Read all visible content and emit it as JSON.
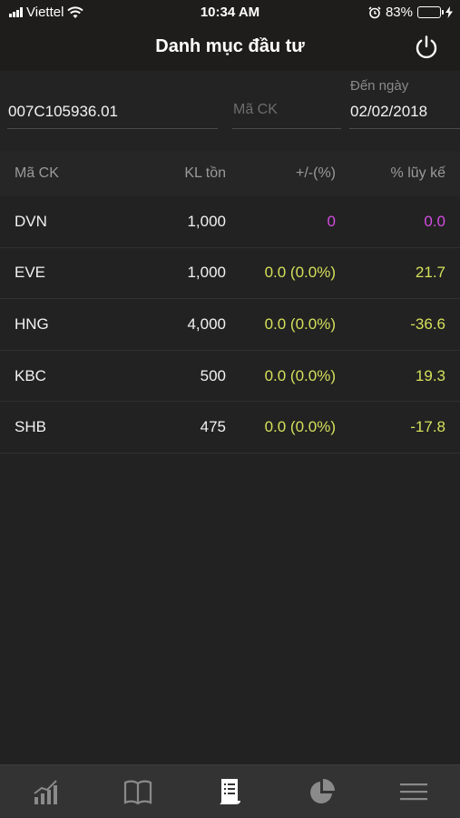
{
  "status_bar": {
    "carrier": "Viettel",
    "time": "10:34 AM",
    "battery_percent": "83%",
    "battery_level": 0.83
  },
  "header": {
    "title": "Danh mục đầu tư",
    "power_icon": "power-icon"
  },
  "filters": {
    "account_value": "007C105936.01",
    "symbol_placeholder": "Mã CK",
    "date_label": "Đến ngày",
    "date_value": "02/02/2018"
  },
  "table": {
    "columns": [
      "Mã CK",
      "KL tồn",
      "+/-(%)",
      "% lũy kế"
    ],
    "rows": [
      {
        "symbol": "DVN",
        "volume": "1,000",
        "change": "0",
        "cumulative": "0.0",
        "color": "#d24ce0"
      },
      {
        "symbol": "EVE",
        "volume": "1,000",
        "change": "0.0 (0.0%)",
        "cumulative": "21.7",
        "color": "#d5e05a"
      },
      {
        "symbol": "HNG",
        "volume": "4,000",
        "change": "0.0 (0.0%)",
        "cumulative": "-36.6",
        "color": "#d5e05a"
      },
      {
        "symbol": "KBC",
        "volume": "500",
        "change": "0.0 (0.0%)",
        "cumulative": "19.3",
        "color": "#d5e05a"
      },
      {
        "symbol": "SHB",
        "volume": "475",
        "change": "0.0 (0.0%)",
        "cumulative": "-17.8",
        "color": "#d5e05a"
      }
    ]
  },
  "tabbar": {
    "tabs": [
      {
        "icon": "market-chart-icon",
        "active": false
      },
      {
        "icon": "book-icon",
        "active": false
      },
      {
        "icon": "order-list-icon",
        "active": true
      },
      {
        "icon": "pie-chart-icon",
        "active": false
      },
      {
        "icon": "menu-icon",
        "active": false
      }
    ]
  },
  "colors": {
    "background": "#222222",
    "header_bg": "#1f1d1b",
    "neutral_price": "#d24ce0",
    "ref_price": "#d5e05a",
    "tab_icon": "#8a8a8a",
    "tab_icon_active": "#ffffff"
  }
}
